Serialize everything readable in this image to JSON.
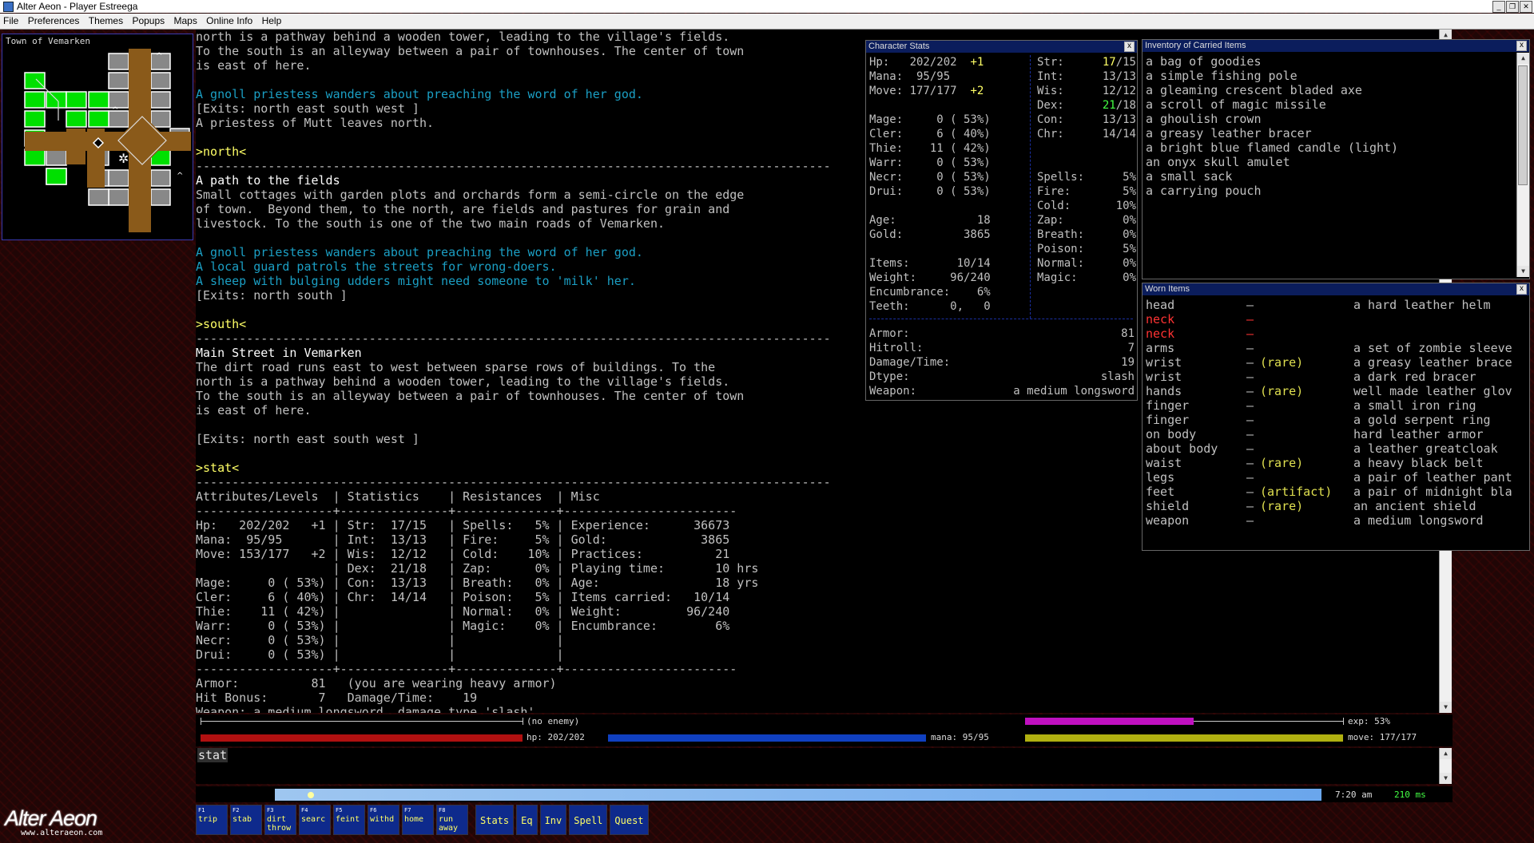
{
  "window": {
    "title": "Alter Aeon - Player Estreega"
  },
  "menu": [
    "File",
    "Preferences",
    "Themes",
    "Popups",
    "Maps",
    "Online Info",
    "Help"
  ],
  "map": {
    "title": "Town of Vemarken"
  },
  "main_text": [
    {
      "t": "north is a pathway behind a wooden tower, leading to the village's fields.",
      "c": ""
    },
    {
      "t": "To the south is an alleyway between a pair of townhouses. The center of town",
      "c": ""
    },
    {
      "t": "is east of here.",
      "c": ""
    },
    {
      "t": "",
      "c": ""
    },
    {
      "t": "A gnoll priestess wanders about preaching the word of her god.",
      "c": "cyan"
    },
    {
      "t": "[Exits: north east south west ]",
      "c": ""
    },
    {
      "t": "A priestess of Mutt leaves north.",
      "c": ""
    },
    {
      "t": "",
      "c": ""
    },
    {
      "t": ">north<",
      "c": "yel"
    },
    {
      "t": "----------------------------------------------------------------------------------------",
      "c": ""
    },
    {
      "t": "A path to the fields",
      "c": "wht"
    },
    {
      "t": "Small cottages with garden plots and orchards form a semi-circle on the edge",
      "c": ""
    },
    {
      "t": "of town.  Beyond them, to the north, are fields and pastures for grain and",
      "c": ""
    },
    {
      "t": "livestock. To the south is one of the two main roads of Vemarken.",
      "c": ""
    },
    {
      "t": "",
      "c": ""
    },
    {
      "t": "A gnoll priestess wanders about preaching the word of her god.",
      "c": "cyan"
    },
    {
      "t": "A local guard patrols the streets for wrong-doers.",
      "c": "cyan"
    },
    {
      "t": "A sheep with bulging udders might need someone to 'milk' her.",
      "c": "cyan"
    },
    {
      "t": "[Exits: north south ]",
      "c": ""
    },
    {
      "t": "",
      "c": ""
    },
    {
      "t": ">south<",
      "c": "yel"
    },
    {
      "t": "----------------------------------------------------------------------------------------",
      "c": ""
    },
    {
      "t": "Main Street in Vemarken",
      "c": "wht"
    },
    {
      "t": "The dirt road runs east to west between sparse rows of buildings. To the",
      "c": ""
    },
    {
      "t": "north is a pathway behind a wooden tower, leading to the village's fields.",
      "c": ""
    },
    {
      "t": "To the south is an alleyway between a pair of townhouses. The center of town",
      "c": ""
    },
    {
      "t": "is east of here.",
      "c": ""
    },
    {
      "t": "",
      "c": ""
    },
    {
      "t": "[Exits: north east south west ]",
      "c": ""
    },
    {
      "t": "",
      "c": ""
    },
    {
      "t": ">stat<",
      "c": "yel"
    },
    {
      "t": "----------------------------------------------------------------------------------------",
      "c": ""
    },
    {
      "t": "Attributes/Levels  | Statistics    | Resistances  | Misc",
      "c": ""
    },
    {
      "t": "-------------------+---------------+--------------+------------------------",
      "c": ""
    },
    {
      "t": "Hp:   202/202   +1 | Str:  17/15   | Spells:   5% | Experience:      36673",
      "c": ""
    },
    {
      "t": "Mana:  95/95       | Int:  13/13   | Fire:     5% | Gold:             3865",
      "c": ""
    },
    {
      "t": "Move: 153/177   +2 | Wis:  12/12   | Cold:    10% | Practices:          21",
      "c": ""
    },
    {
      "t": "                   | Dex:  21/18   | Zap:      0% | Playing time:       10 hrs",
      "c": ""
    },
    {
      "t": "Mage:     0 ( 53%) | Con:  13/13   | Breath:   0% | Age:                18 yrs",
      "c": ""
    },
    {
      "t": "Cler:     6 ( 40%) | Chr:  14/14   | Poison:   5% | Items carried:   10/14",
      "c": ""
    },
    {
      "t": "Thie:    11 ( 42%) |               | Normal:   0% | Weight:         96/240",
      "c": ""
    },
    {
      "t": "Warr:     0 ( 53%) |               | Magic:    0% | Encumbrance:        6%",
      "c": ""
    },
    {
      "t": "Necr:     0 ( 53%) |               |              |",
      "c": ""
    },
    {
      "t": "Drui:     0 ( 53%) |               |              |",
      "c": ""
    },
    {
      "t": "-------------------+---------------+--------------+------------------------",
      "c": ""
    },
    {
      "t": "Armor:          81   (you are wearing heavy armor)",
      "c": ""
    },
    {
      "t": "Hit Bonus:       7   Damage/Time:    19",
      "c": ""
    },
    {
      "t": "Weapon: a medium longsword, damage type 'slash'",
      "c": ""
    }
  ],
  "char_stats": {
    "title": "Character Stats",
    "left": [
      [
        "Hp:   202/202  ",
        "+1"
      ],
      [
        "Mana:  95/95   ",
        ""
      ],
      [
        "Move: 177/177  ",
        "+2"
      ],
      [
        "",
        ""
      ],
      [
        "Mage:     0 ( 53%)",
        ""
      ],
      [
        "Cler:     6 ( 40%)",
        ""
      ],
      [
        "Thie:    11 ( 42%)",
        ""
      ],
      [
        "Warr:     0 ( 53%)",
        ""
      ],
      [
        "Necr:     0 ( 53%)",
        ""
      ],
      [
        "Drui:     0 ( 53%)",
        ""
      ],
      [
        "",
        ""
      ],
      [
        "Age:            18",
        ""
      ],
      [
        "Gold:         3865",
        ""
      ],
      [
        "",
        ""
      ],
      [
        "Items:       10/14",
        ""
      ],
      [
        "Weight:     96/240",
        ""
      ],
      [
        "Encumbrance:    6%",
        ""
      ],
      [
        "Teeth:      0,   0",
        ""
      ]
    ],
    "right": [
      [
        "Str:     ",
        "17",
        "/15"
      ],
      [
        "Int:     ",
        "",
        "13/13"
      ],
      [
        "Wis:     ",
        "",
        "12/12"
      ],
      [
        "Dex:     ",
        "21",
        "/18"
      ],
      [
        "Con:     ",
        "",
        "13/13"
      ],
      [
        "Chr:     ",
        "",
        "14/14"
      ],
      [
        "",
        "",
        ""
      ],
      [
        "",
        "",
        ""
      ],
      [
        "Spells:   ",
        "",
        "5%"
      ],
      [
        "Fire:     ",
        "",
        "5%"
      ],
      [
        "Cold:    ",
        "",
        "10%"
      ],
      [
        "Zap:      ",
        "",
        "0%"
      ],
      [
        "Breath:   ",
        "",
        "0%"
      ],
      [
        "Poison:   ",
        "",
        "5%"
      ],
      [
        "Normal:   ",
        "",
        "0%"
      ],
      [
        "Magic:    ",
        "",
        "0%"
      ]
    ],
    "bottom": [
      [
        "Armor:",
        "81"
      ],
      [
        "Hitroll:",
        "7"
      ],
      [
        "Damage/Time:",
        "19"
      ],
      [
        "Dtype:",
        "slash"
      ],
      [
        "Weapon:",
        "a medium longsword"
      ]
    ]
  },
  "inventory": {
    "title": "Inventory of Carried Items",
    "items": [
      "a bag of goodies",
      "a simple fishing pole",
      "a gleaming crescent bladed axe",
      "a scroll of magic missile",
      "a ghoulish crown",
      "a greasy leather bracer",
      "a bright blue flamed candle (light)",
      "an onyx skull amulet",
      "a small sack",
      "a carrying pouch"
    ]
  },
  "worn": {
    "title": "Worn Items",
    "items": [
      {
        "slot": "head",
        "tag": "",
        "item": "a hard leather helm",
        "red": false
      },
      {
        "slot": "neck",
        "tag": "",
        "item": "",
        "red": true
      },
      {
        "slot": "neck",
        "tag": "",
        "item": "",
        "red": true
      },
      {
        "slot": "arms",
        "tag": "",
        "item": "a set of zombie sleeve",
        "red": false
      },
      {
        "slot": "wrist",
        "tag": "(rare)",
        "item": "a greasy leather brace",
        "red": false
      },
      {
        "slot": "wrist",
        "tag": "",
        "item": "a dark red bracer",
        "red": false
      },
      {
        "slot": "hands",
        "tag": "(rare)",
        "item": "well made leather glov",
        "red": false
      },
      {
        "slot": "finger",
        "tag": "",
        "item": "a small iron ring",
        "red": false
      },
      {
        "slot": "finger",
        "tag": "",
        "item": "a gold serpent ring",
        "red": false
      },
      {
        "slot": "on body",
        "tag": "",
        "item": "hard leather armor",
        "red": false
      },
      {
        "slot": "about body",
        "tag": "",
        "item": "a leather greatcloak",
        "red": false
      },
      {
        "slot": "waist",
        "tag": "(rare)",
        "item": "a heavy black belt",
        "red": false
      },
      {
        "slot": "legs",
        "tag": "",
        "item": "a pair of leather pant",
        "red": false
      },
      {
        "slot": "feet",
        "tag": "(artifact)",
        "item": "a pair of midnight bla",
        "red": false
      },
      {
        "slot": "shield",
        "tag": "(rare)",
        "item": "an ancient shield",
        "red": false
      },
      {
        "slot": "weapon",
        "tag": "",
        "item": "a medium longsword",
        "red": false
      }
    ]
  },
  "bars": {
    "enemy": "(no enemy)",
    "exp_label": "exp: 53%",
    "exp": 0.53,
    "hp_label": "hp: 202/202",
    "hp": 1.0,
    "mana_label": "mana:  95/95",
    "mana": 1.0,
    "move_label": "move: 177/177",
    "move": 1.0
  },
  "command": {
    "text": "stat"
  },
  "time": {
    "clock": "7:20 am",
    "ping": "210 ms"
  },
  "hotkeys": [
    {
      "n": "F1",
      "l": "trip"
    },
    {
      "n": "F2",
      "l": "stab"
    },
    {
      "n": "F3",
      "l": "dirt throw"
    },
    {
      "n": "F4",
      "l": "searc"
    },
    {
      "n": "F5",
      "l": "feint"
    },
    {
      "n": "F6",
      "l": "withd"
    },
    {
      "n": "F7",
      "l": "home"
    },
    {
      "n": "F8",
      "l": "run away"
    }
  ],
  "panel_buttons": [
    "Stats",
    "Eq",
    "Inv",
    "Spell",
    "Quest"
  ],
  "logo": {
    "name": "Alter Aeon",
    "url": "www.alteraeon.com"
  },
  "colors": {
    "panel_title": "#0b1d5c",
    "hp": "#b01010",
    "mana": "#1040c0",
    "move": "#b0b010",
    "exp": "#c010c0"
  }
}
